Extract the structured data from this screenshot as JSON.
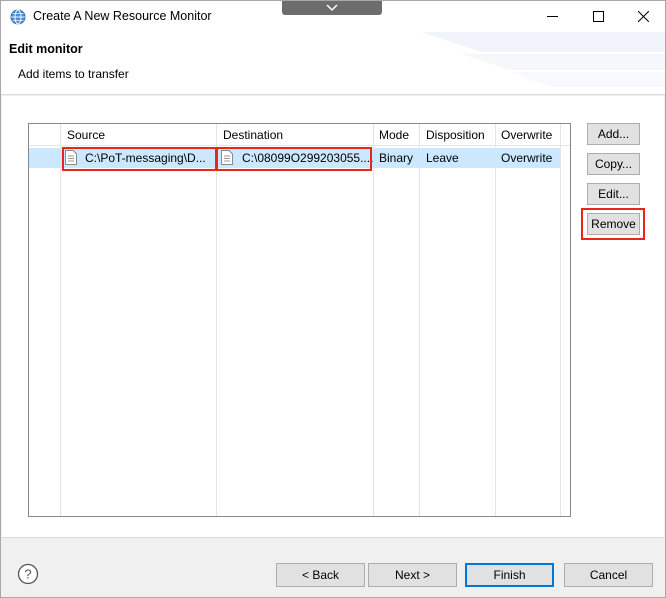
{
  "window": {
    "title": "Create A New Resource Monitor"
  },
  "header": {
    "title": "Edit monitor",
    "subtitle": "Add items to transfer"
  },
  "table": {
    "columns": [
      "Source",
      "Destination",
      "Mode",
      "Disposition",
      "Overwrite"
    ],
    "rows": [
      {
        "source": "C:\\PoT-messaging\\D...",
        "destination": "C:\\08099O299203055....",
        "mode": "Binary",
        "disposition": "Leave",
        "overwrite": "Overwrite",
        "selected": true
      }
    ]
  },
  "side_buttons": {
    "add": "Add...",
    "copy": "Copy...",
    "edit": "Edit...",
    "remove": "Remove"
  },
  "footer": {
    "back": "< Back",
    "next": "Next >",
    "finish": "Finish",
    "cancel": "Cancel"
  },
  "colors": {
    "selection": "#cce8ff",
    "highlight": "#e8261a",
    "primary_border": "#0078d7"
  },
  "icons": [
    "globe-icon",
    "chevron-down-icon",
    "minimize-icon",
    "maximize-icon",
    "close-icon",
    "file-icon",
    "help-icon"
  ]
}
